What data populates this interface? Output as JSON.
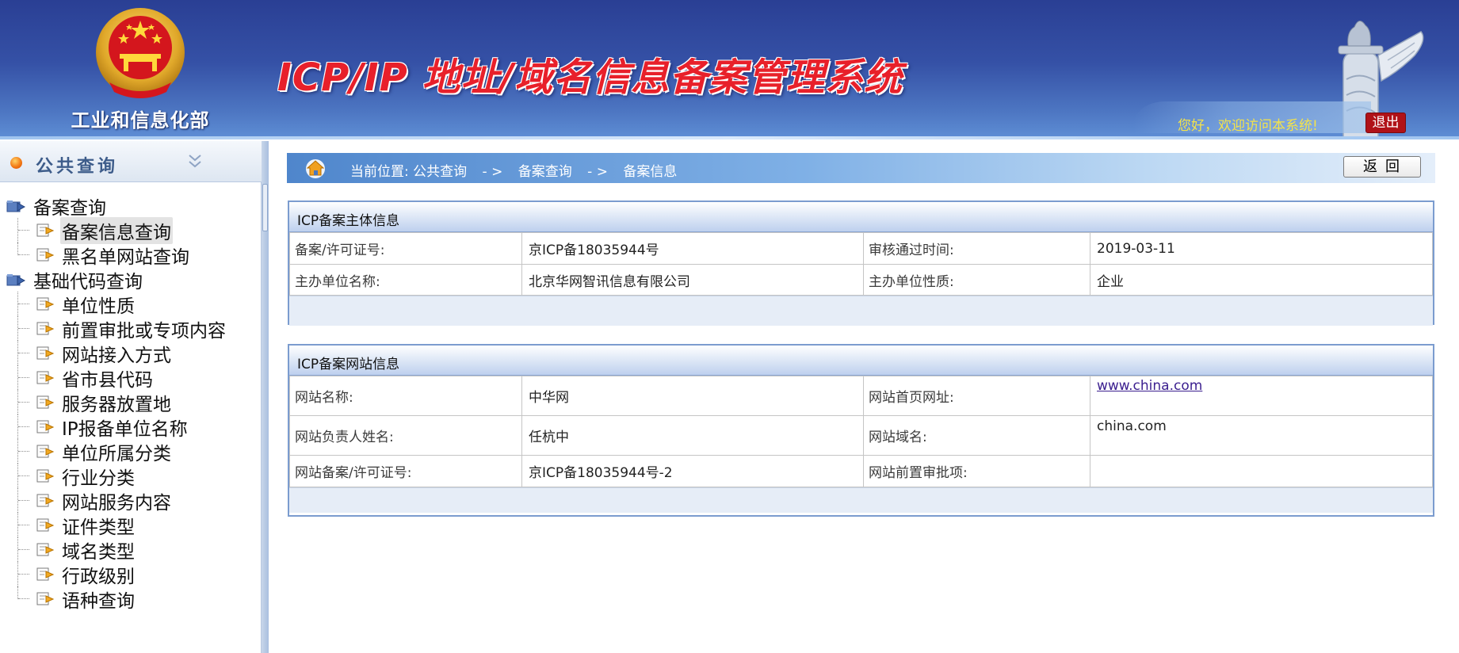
{
  "header": {
    "ministry_name": "工业和信息化部",
    "system_title": "ICP/IP 地址/域名信息备案管理系统",
    "welcome_text": "您好，欢迎访问本系统!",
    "logout_label": "退出"
  },
  "sidebar": {
    "title": "公共查询",
    "groups": [
      {
        "label": "备案查询",
        "items": [
          {
            "label": "备案信息查询"
          },
          {
            "label": "黑名单网站查询"
          }
        ]
      },
      {
        "label": "基础代码查询",
        "items": [
          {
            "label": "单位性质"
          },
          {
            "label": "前置审批或专项内容"
          },
          {
            "label": "网站接入方式"
          },
          {
            "label": "省市县代码"
          },
          {
            "label": "服务器放置地"
          },
          {
            "label": "IP报备单位名称"
          },
          {
            "label": "单位所属分类"
          },
          {
            "label": "行业分类"
          },
          {
            "label": "网站服务内容"
          },
          {
            "label": "证件类型"
          },
          {
            "label": "域名类型"
          },
          {
            "label": "行政级别"
          },
          {
            "label": "语种查询"
          }
        ]
      }
    ]
  },
  "breadcrumb": {
    "prefix": "当前位置:",
    "items": [
      "公共查询",
      "备案查询",
      "备案信息"
    ],
    "separator": "- >",
    "back_label": "返回"
  },
  "subject_panel": {
    "title": "ICP备案主体信息",
    "rows": [
      [
        {
          "label": "备案/许可证号:",
          "value": "京ICP备18035944号"
        },
        {
          "label": "审核通过时间:",
          "value": "2019-03-11"
        }
      ],
      [
        {
          "label": "主办单位名称:",
          "value": "北京华网智讯信息有限公司"
        },
        {
          "label": "主办单位性质:",
          "value": "企业"
        }
      ]
    ]
  },
  "site_panel": {
    "title": "ICP备案网站信息",
    "rows": [
      [
        {
          "label": "网站名称:",
          "value": "中华网"
        },
        {
          "label": "网站首页网址:",
          "value": "www.china.com"
        }
      ],
      [
        {
          "label": "网站负责人姓名:",
          "value": "任杭中"
        },
        {
          "label": "网站域名:",
          "value": "china.com"
        }
      ],
      [
        {
          "label": "网站备案/许可证号:",
          "value": "京ICP备18035944号-2"
        },
        {
          "label": "网站前置审批项:",
          "value": ""
        }
      ]
    ]
  },
  "colors": {
    "header_top": "#2a3f94",
    "title_red": "#e8202a",
    "welcome_yellow": "#f4e34a",
    "logout_red": "#b01218",
    "panel_border": "#7b9ccf"
  },
  "icons": [
    "national-emblem-icon",
    "huabiao-pillar-icon",
    "orange-dot-icon",
    "chevron-double-down-icon",
    "folder-arrow-icon",
    "document-arrow-icon",
    "home-icon"
  ]
}
